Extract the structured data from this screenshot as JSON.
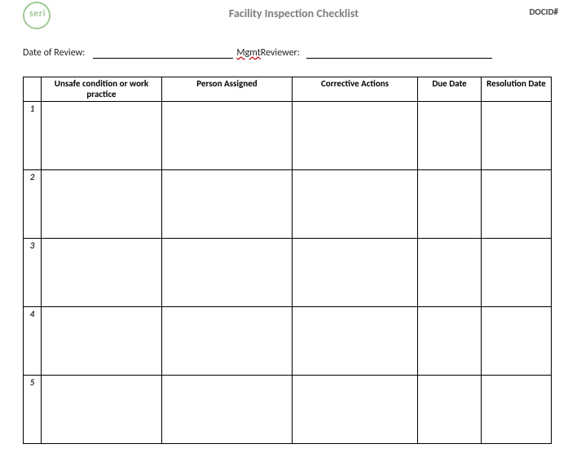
{
  "header": {
    "logo_text": "seri",
    "title": "Facility Inspection Checklist",
    "docid_label": "DOCID#"
  },
  "meta": {
    "date_label": "Date of Review:",
    "reviewer_prefix": "Mgmt",
    "reviewer_suffix": "Reviewer:"
  },
  "table": {
    "headers": {
      "num": "",
      "condition": "Unsafe condition or work practice",
      "person": "Person Assigned",
      "actions": "Corrective Actions",
      "due": "Due Date",
      "resolution": "Resolution Date"
    },
    "rows": [
      {
        "num": "1",
        "condition": "",
        "person": "",
        "actions": "",
        "due": "",
        "resolution": ""
      },
      {
        "num": "2",
        "condition": "",
        "person": "",
        "actions": "",
        "due": "",
        "resolution": ""
      },
      {
        "num": "3",
        "condition": "",
        "person": "",
        "actions": "",
        "due": "",
        "resolution": ""
      },
      {
        "num": "4",
        "condition": "",
        "person": "",
        "actions": "",
        "due": "",
        "resolution": ""
      },
      {
        "num": "5",
        "condition": "",
        "person": "",
        "actions": "",
        "due": "",
        "resolution": ""
      }
    ]
  }
}
